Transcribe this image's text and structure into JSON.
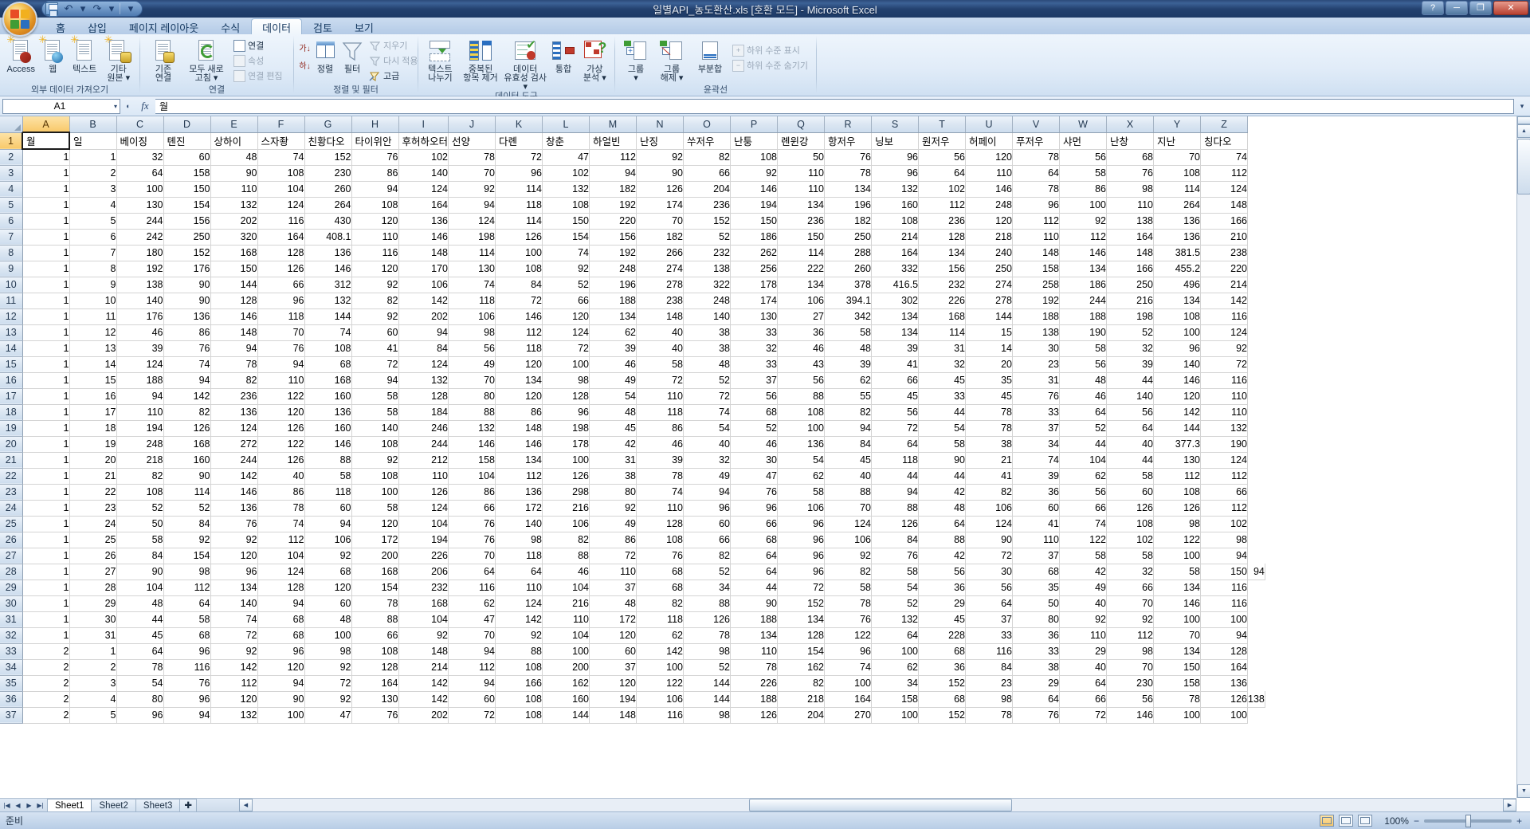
{
  "window": {
    "title": "일별API_농도환산.xls [호환 모드] - Microsoft Excel",
    "minimize": "─",
    "maximize": "❐",
    "close": "✕",
    "help": "?"
  },
  "quick_access": {
    "save": "save-icon",
    "undo": "↶",
    "redo": "↷",
    "customize": "▾"
  },
  "tabs": [
    {
      "label": "홈",
      "active": false
    },
    {
      "label": "삽입",
      "active": false
    },
    {
      "label": "페이지 레이아웃",
      "active": false
    },
    {
      "label": "수식",
      "active": false
    },
    {
      "label": "데이터",
      "active": true
    },
    {
      "label": "검토",
      "active": false
    },
    {
      "label": "보기",
      "active": false
    }
  ],
  "ribbon": {
    "groups": [
      {
        "label": "외부 데이터 가져오기",
        "big_buttons": [
          {
            "label": "Access",
            "icon": "access-import-icon"
          },
          {
            "label": "웹",
            "icon": "web-import-icon"
          },
          {
            "label": "텍스트",
            "icon": "text-import-icon"
          },
          {
            "label": "기타\n원본 ▾",
            "icon": "other-sources-icon"
          }
        ]
      },
      {
        "label": "연결",
        "big_buttons": [
          {
            "label": "기존\n연결",
            "icon": "existing-connections-icon"
          },
          {
            "label": "모두 새로\n고침 ▾",
            "icon": "refresh-all-icon"
          }
        ],
        "small_buttons": [
          {
            "label": "연결",
            "icon": "connections-icon",
            "disabled": false
          },
          {
            "label": "속성",
            "icon": "properties-icon",
            "disabled": true
          },
          {
            "label": "연결 편집",
            "icon": "edit-links-icon",
            "disabled": true
          }
        ]
      },
      {
        "label": "정렬 및 필터",
        "big_buttons": [
          {
            "label": "정렬",
            "icon": "sort-icon"
          },
          {
            "label": "필터",
            "icon": "filter-icon"
          }
        ],
        "sort_small": [
          {
            "label": "",
            "icon": "sort-asc-icon"
          },
          {
            "label": "",
            "icon": "sort-desc-icon"
          }
        ],
        "small_buttons": [
          {
            "label": "지우기",
            "icon": "clear-filter-icon",
            "disabled": true
          },
          {
            "label": "다시 적용",
            "icon": "reapply-icon",
            "disabled": true
          },
          {
            "label": "고급",
            "icon": "advanced-filter-icon",
            "disabled": false
          }
        ]
      },
      {
        "label": "데이터 도구",
        "big_buttons": [
          {
            "label": "텍스트\n나누기",
            "icon": "text-to-columns-icon"
          },
          {
            "label": "중복된\n항목 제거",
            "icon": "remove-duplicates-icon"
          },
          {
            "label": "데이터\n유효성 검사 ▾",
            "icon": "data-validation-icon"
          },
          {
            "label": "통합",
            "icon": "consolidate-icon"
          },
          {
            "label": "가상\n분석 ▾",
            "icon": "what-if-analysis-icon"
          }
        ]
      },
      {
        "label": "윤곽선",
        "big_buttons": [
          {
            "label": "그룹\n▾",
            "icon": "group-icon"
          },
          {
            "label": "그룹\n해제 ▾",
            "icon": "ungroup-icon"
          },
          {
            "label": "부분합",
            "icon": "subtotal-icon"
          }
        ],
        "small_buttons": [
          {
            "label": "하위 수준 표시",
            "icon": "show-detail-icon",
            "disabled": true
          },
          {
            "label": "하위 수준 숨기기",
            "icon": "hide-detail-icon",
            "disabled": true
          }
        ]
      }
    ]
  },
  "formula_bar": {
    "name_box": "A1",
    "name_box_caret": "▾",
    "insert_function": "fx",
    "formula_value": "월",
    "expand": "▾"
  },
  "grid": {
    "columns": [
      "A",
      "B",
      "C",
      "D",
      "E",
      "F",
      "G",
      "H",
      "I",
      "J",
      "K",
      "L",
      "M",
      "N",
      "O",
      "P",
      "Q",
      "R",
      "S",
      "T",
      "U",
      "V",
      "W",
      "X",
      "Y",
      "Z"
    ],
    "selected_column": "A",
    "selected_row": 1,
    "active_cell": "A1",
    "header_row": [
      "월",
      "일",
      "베이징",
      "톈진",
      "상하이",
      "스자좡",
      "친황다오",
      "타이위안",
      "후허하오터",
      "선양",
      "다롄",
      "창춘",
      "하얼빈",
      "난징",
      "쑤저우",
      "난퉁",
      "롄윈강",
      "항저우",
      "닝보",
      "원저우",
      "허페이",
      "푸저우",
      "샤먼",
      "난창",
      "지난",
      "칭다오"
    ],
    "rows": [
      [
        1,
        1,
        32,
        60,
        48,
        74,
        152,
        76,
        102,
        78,
        72,
        47,
        112,
        92,
        82,
        108,
        50,
        76,
        96,
        56,
        120,
        78,
        56,
        68,
        70,
        74
      ],
      [
        1,
        2,
        64,
        158,
        90,
        108,
        230,
        86,
        140,
        70,
        96,
        102,
        94,
        90,
        66,
        92,
        110,
        78,
        96,
        64,
        110,
        64,
        58,
        76,
        108,
        112
      ],
      [
        1,
        3,
        100,
        150,
        110,
        104,
        260,
        94,
        124,
        92,
        114,
        132,
        182,
        126,
        204,
        146,
        110,
        134,
        132,
        102,
        146,
        78,
        86,
        98,
        114,
        124
      ],
      [
        1,
        4,
        130,
        154,
        132,
        124,
        264,
        108,
        164,
        94,
        118,
        108,
        192,
        174,
        236,
        194,
        134,
        196,
        160,
        112,
        248,
        96,
        100,
        110,
        264,
        148
      ],
      [
        1,
        5,
        244,
        156,
        202,
        116,
        430,
        120,
        136,
        124,
        114,
        150,
        220,
        70,
        152,
        150,
        236,
        182,
        108,
        236,
        120,
        112,
        92,
        138,
        136,
        166
      ],
      [
        1,
        6,
        242,
        250,
        320,
        164,
        408.1,
        110,
        146,
        198,
        126,
        154,
        156,
        182,
        52,
        186,
        150,
        250,
        214,
        128,
        218,
        110,
        112,
        164,
        136,
        210
      ],
      [
        1,
        7,
        180,
        152,
        168,
        128,
        136,
        116,
        148,
        114,
        100,
        74,
        192,
        266,
        232,
        262,
        114,
        288,
        164,
        134,
        240,
        148,
        146,
        148,
        381.5,
        238
      ],
      [
        1,
        8,
        192,
        176,
        150,
        126,
        146,
        120,
        170,
        130,
        108,
        92,
        248,
        274,
        138,
        256,
        222,
        260,
        332,
        156,
        250,
        158,
        134,
        166,
        455.2,
        220
      ],
      [
        1,
        9,
        138,
        90,
        144,
        66,
        312,
        92,
        106,
        74,
        84,
        52,
        196,
        278,
        322,
        178,
        134,
        378,
        416.5,
        232,
        274,
        258,
        186,
        250,
        496,
        214
      ],
      [
        1,
        10,
        140,
        90,
        128,
        96,
        132,
        82,
        142,
        118,
        72,
        66,
        188,
        238,
        248,
        174,
        106,
        394.1,
        302,
        226,
        278,
        192,
        244,
        216,
        134,
        142
      ],
      [
        1,
        11,
        176,
        136,
        146,
        118,
        144,
        92,
        202,
        106,
        146,
        120,
        134,
        148,
        140,
        130,
        27,
        342,
        134,
        168,
        144,
        188,
        188,
        198,
        108,
        116
      ],
      [
        1,
        12,
        46,
        86,
        148,
        70,
        74,
        60,
        94,
        98,
        112,
        124,
        62,
        40,
        38,
        33,
        36,
        58,
        134,
        114,
        15,
        138,
        190,
        52,
        100,
        124
      ],
      [
        1,
        13,
        39,
        76,
        94,
        76,
        108,
        41,
        84,
        56,
        118,
        72,
        39,
        40,
        38,
        32,
        46,
        48,
        39,
        31,
        14,
        30,
        58,
        32,
        96,
        92
      ],
      [
        1,
        14,
        124,
        74,
        78,
        94,
        68,
        72,
        124,
        49,
        120,
        100,
        46,
        58,
        48,
        33,
        43,
        39,
        41,
        32,
        20,
        23,
        56,
        39,
        140,
        72
      ],
      [
        1,
        15,
        188,
        94,
        82,
        110,
        168,
        94,
        132,
        70,
        134,
        98,
        49,
        72,
        52,
        37,
        56,
        62,
        66,
        45,
        35,
        31,
        48,
        44,
        146,
        116
      ],
      [
        1,
        16,
        94,
        142,
        236,
        122,
        160,
        58,
        128,
        80,
        120,
        128,
        54,
        110,
        72,
        56,
        88,
        55,
        45,
        33,
        45,
        76,
        46,
        140,
        120,
        110
      ],
      [
        1,
        17,
        110,
        82,
        136,
        120,
        136,
        58,
        184,
        88,
        86,
        96,
        48,
        118,
        74,
        68,
        108,
        82,
        56,
        44,
        78,
        33,
        64,
        56,
        142,
        110
      ],
      [
        1,
        18,
        194,
        126,
        124,
        126,
        160,
        140,
        246,
        132,
        148,
        198,
        45,
        86,
        54,
        52,
        100,
        94,
        72,
        54,
        78,
        37,
        52,
        64,
        144,
        132
      ],
      [
        1,
        19,
        248,
        168,
        272,
        122,
        146,
        108,
        244,
        146,
        146,
        178,
        42,
        46,
        40,
        46,
        136,
        84,
        64,
        58,
        38,
        34,
        44,
        40,
        377.3,
        190
      ],
      [
        1,
        20,
        218,
        160,
        244,
        126,
        88,
        92,
        212,
        158,
        134,
        100,
        31,
        39,
        32,
        30,
        54,
        45,
        118,
        90,
        21,
        74,
        104,
        44,
        130,
        124
      ],
      [
        1,
        21,
        82,
        90,
        142,
        40,
        58,
        108,
        110,
        104,
        112,
        126,
        38,
        78,
        49,
        47,
        62,
        40,
        44,
        44,
        41,
        39,
        62,
        58,
        112,
        112
      ],
      [
        1,
        22,
        108,
        114,
        146,
        86,
        118,
        100,
        126,
        86,
        136,
        298,
        80,
        74,
        94,
        76,
        58,
        88,
        94,
        42,
        82,
        36,
        56,
        60,
        108,
        66
      ],
      [
        1,
        23,
        52,
        52,
        136,
        78,
        60,
        58,
        124,
        66,
        172,
        216,
        92,
        110,
        96,
        96,
        106,
        70,
        88,
        48,
        106,
        60,
        66,
        126,
        126,
        112
      ],
      [
        1,
        24,
        50,
        84,
        76,
        74,
        94,
        120,
        104,
        76,
        140,
        106,
        49,
        128,
        60,
        66,
        96,
        124,
        126,
        64,
        124,
        41,
        74,
        108,
        98,
        102
      ],
      [
        1,
        25,
        58,
        92,
        92,
        112,
        106,
        172,
        194,
        76,
        98,
        82,
        86,
        108,
        66,
        68,
        96,
        106,
        84,
        88,
        90,
        110,
        122,
        102,
        122,
        98
      ],
      [
        1,
        26,
        84,
        154,
        120,
        104,
        92,
        200,
        226,
        70,
        118,
        88,
        72,
        76,
        82,
        64,
        96,
        92,
        76,
        42,
        72,
        37,
        58,
        58,
        100,
        94
      ],
      [
        1,
        27,
        90,
        98,
        96,
        124,
        68,
        168,
        206,
        64,
        64,
        46,
        110,
        68,
        52,
        64,
        96,
        82,
        58,
        56,
        30,
        68,
        42,
        32,
        58,
        150,
        94
      ],
      [
        1,
        28,
        104,
        112,
        134,
        128,
        120,
        154,
        232,
        116,
        110,
        104,
        37,
        68,
        34,
        44,
        72,
        58,
        54,
        36,
        56,
        35,
        49,
        66,
        134,
        116
      ],
      [
        1,
        29,
        48,
        64,
        140,
        94,
        60,
        78,
        168,
        62,
        124,
        216,
        48,
        82,
        88,
        90,
        152,
        78,
        52,
        29,
        64,
        50,
        40,
        70,
        146,
        116
      ],
      [
        1,
        30,
        44,
        58,
        74,
        68,
        48,
        88,
        104,
        47,
        142,
        110,
        172,
        118,
        126,
        188,
        134,
        76,
        132,
        45,
        37,
        80,
        92,
        92,
        100,
        100
      ],
      [
        1,
        31,
        45,
        68,
        72,
        68,
        100,
        66,
        92,
        70,
        92,
        104,
        120,
        62,
        78,
        134,
        128,
        122,
        64,
        228,
        33,
        36,
        110,
        112,
        70,
        94
      ],
      [
        2,
        1,
        64,
        96,
        92,
        96,
        98,
        108,
        148,
        94,
        88,
        100,
        60,
        142,
        98,
        110,
        154,
        96,
        100,
        68,
        116,
        33,
        29,
        98,
        134,
        128
      ],
      [
        2,
        2,
        78,
        116,
        142,
        120,
        92,
        128,
        214,
        112,
        108,
        200,
        37,
        100,
        52,
        78,
        162,
        74,
        62,
        36,
        84,
        38,
        40,
        70,
        150,
        164
      ],
      [
        2,
        3,
        54,
        76,
        112,
        94,
        72,
        164,
        142,
        94,
        166,
        162,
        120,
        122,
        144,
        226,
        82,
        100,
        34,
        152,
        23,
        29,
        64,
        230,
        158,
        136
      ],
      [
        2,
        4,
        80,
        96,
        120,
        90,
        92,
        130,
        142,
        60,
        108,
        160,
        194,
        106,
        144,
        188,
        218,
        164,
        158,
        68,
        98,
        64,
        66,
        56,
        78,
        126,
        138
      ],
      [
        2,
        5,
        96,
        94,
        132,
        100,
        47,
        76,
        202,
        72,
        108,
        144,
        148,
        116,
        98,
        126,
        204,
        270,
        100,
        152,
        78,
        76,
        72,
        146,
        100,
        100
      ]
    ]
  },
  "scrollbars": {
    "up": "▲",
    "down": "▼",
    "left": "◀",
    "right": "▶",
    "split_prev": "⊼",
    "split_next": "⊻"
  },
  "sheet_tabs": {
    "nav": [
      "|◀",
      "◀",
      "▶",
      "▶|"
    ],
    "sheets": [
      {
        "label": "Sheet1",
        "active": true
      },
      {
        "label": "Sheet2",
        "active": false
      },
      {
        "label": "Sheet3",
        "active": false
      }
    ],
    "insert_sheet": "✚"
  },
  "status_bar": {
    "mode": "준비",
    "view_normal": "normal-view-icon",
    "view_layout": "page-layout-view-icon",
    "view_break": "page-break-view-icon",
    "zoom": "100%",
    "zoom_out": "−",
    "zoom_in": "+"
  }
}
